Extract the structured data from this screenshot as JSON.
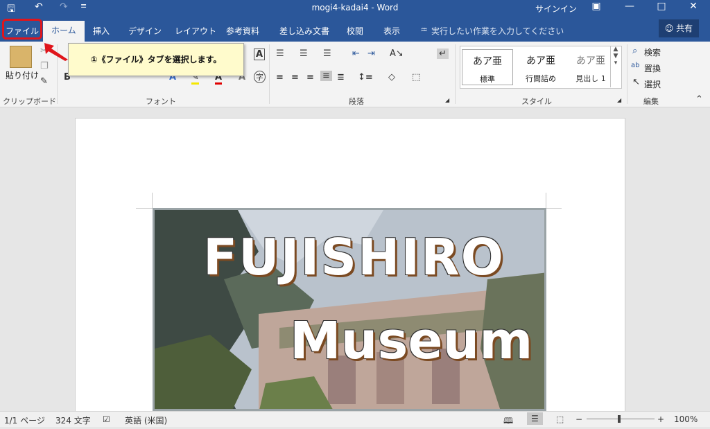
{
  "titlebar": {
    "title": "mogi4-kadai4  -  Word",
    "signin": "サインイン",
    "save_icon": "save-icon",
    "undo_icon": "undo-icon",
    "redo_icon": "redo-icon"
  },
  "tabs": {
    "file": "ファイル",
    "home": "ホーム",
    "insert": "挿入",
    "design": "デザイン",
    "layout": "レイアウト",
    "references": "参考資料",
    "mailings": "差し込み文書",
    "review": "校閲",
    "view": "表示",
    "tell_me": "実行したい作業を入力してください",
    "share": "共有"
  },
  "ribbon": {
    "paste": "貼り付け",
    "clipboard": "クリップボード",
    "font": "フォント",
    "paragraph": "段落",
    "styles": "スタイル",
    "editing": "編集",
    "find": "検索",
    "replace": "置換",
    "select": "選択",
    "style_items": [
      {
        "sample": "あア亜",
        "name": "標準"
      },
      {
        "sample": "あア亜",
        "name": "行間詰め"
      },
      {
        "sample": "あア亜",
        "name": "見出し 1"
      }
    ]
  },
  "callout": {
    "text": "①《ファイル》タブを選択します。"
  },
  "document": {
    "title_line1": "FUJISHIRO",
    "title_line2": "Museum"
  },
  "status": {
    "page": "1/1 ページ",
    "words": "324 文字",
    "language": "英語 (米国)",
    "zoom": "100%"
  },
  "colors": {
    "accent": "#2b579a",
    "highlight_border": "#e0151b",
    "callout_bg": "#fffbcc"
  }
}
